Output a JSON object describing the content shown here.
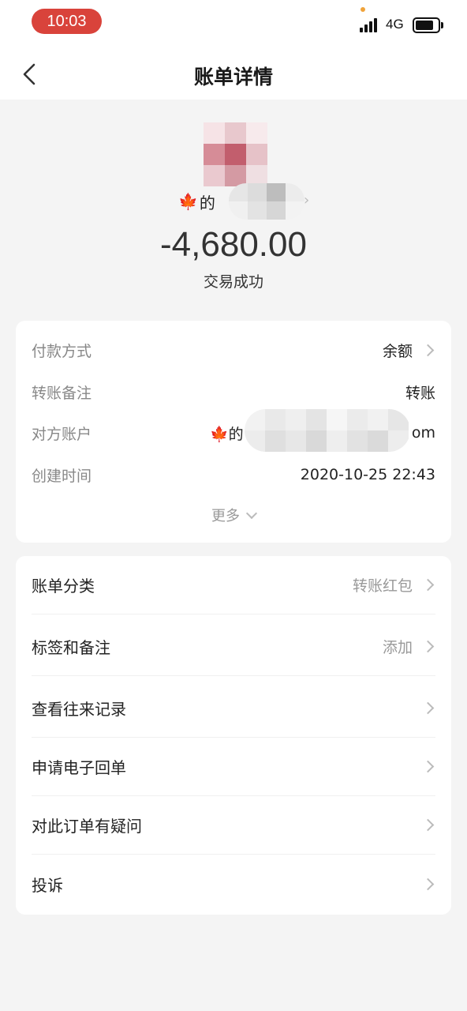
{
  "status_bar": {
    "time": "10:03",
    "network": "4G",
    "battery_level": 0.8
  },
  "nav": {
    "title": "账单详情"
  },
  "summary": {
    "payee_prefix": "的",
    "payee_emoji": "🍁",
    "amount": "-4,680.00",
    "status": "交易成功"
  },
  "details": [
    {
      "label": "付款方式",
      "value": "余额",
      "chevron": true
    },
    {
      "label": "转账备注",
      "value": "转账",
      "chevron": false
    },
    {
      "label": "对方账户",
      "value_prefix": "🍁的",
      "value_suffix": "om",
      "chevron": false
    },
    {
      "label": "创建时间",
      "value": "2020-10-25 22:43",
      "chevron": false
    }
  ],
  "more_label": "更多",
  "menu": [
    {
      "label": "账单分类",
      "value": "转账红包"
    },
    {
      "label": "标签和备注",
      "value": "添加"
    },
    {
      "label": "查看往来记录",
      "value": ""
    },
    {
      "label": "申请电子回单",
      "value": ""
    },
    {
      "label": "对此订单有疑问",
      "value": ""
    },
    {
      "label": "投诉",
      "value": ""
    }
  ],
  "colors": {
    "time_pill": "#d9433b",
    "background": "#f4f4f4",
    "card": "#ffffff"
  }
}
